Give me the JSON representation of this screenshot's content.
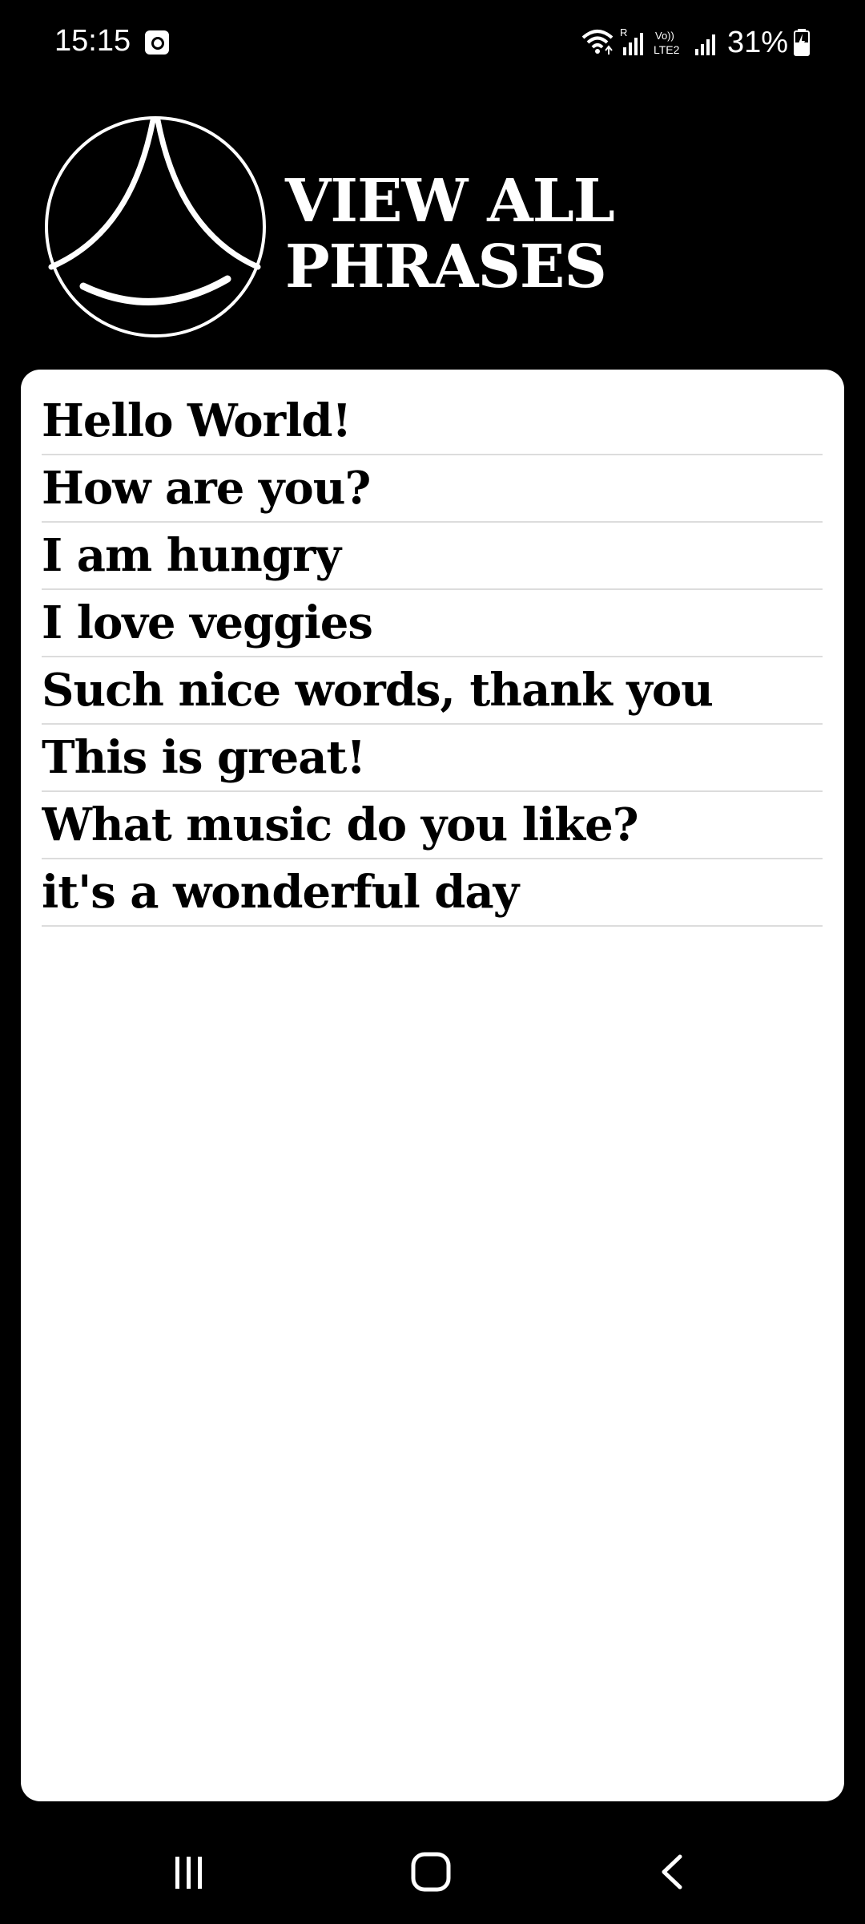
{
  "status_bar": {
    "time": "15:15",
    "battery": "31%",
    "network_labels": [
      "R",
      "Vo)) LTE2"
    ]
  },
  "header": {
    "title": "VIEW ALL PHRASES",
    "logo": "app-logo-arch-circle"
  },
  "phrases": [
    "Hello World!",
    "How are you?",
    "I am hungry",
    "I love veggies",
    "Such nice words, thank you",
    "This is great!",
    "What music do you like?",
    "it's a wonderful day"
  ],
  "nav": {
    "recent": "recent-apps-icon",
    "home": "home-icon",
    "back": "back-icon"
  },
  "colors": {
    "background": "#000000",
    "card": "#ffffff",
    "text_dark": "#000000",
    "divider": "#dcdcdc"
  }
}
